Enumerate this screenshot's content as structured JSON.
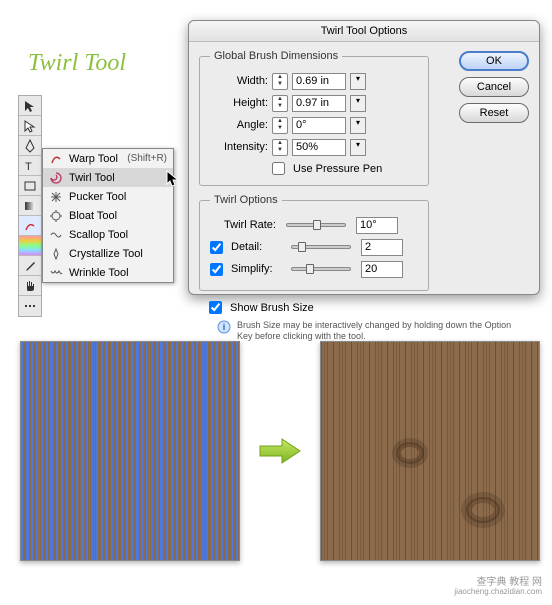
{
  "page_title": "Twirl Tool",
  "toolbar_tools": [
    "selection",
    "direct-select",
    "pen",
    "type",
    "shape",
    "gradient",
    "warp",
    "swatch"
  ],
  "flyout": {
    "items": [
      {
        "icon": "warp-icon",
        "label": "Warp Tool",
        "shortcut": "(Shift+R)",
        "selected": false
      },
      {
        "icon": "twirl-icon",
        "label": "Twirl Tool",
        "shortcut": "",
        "selected": true
      },
      {
        "icon": "pucker-icon",
        "label": "Pucker Tool",
        "shortcut": "",
        "selected": false
      },
      {
        "icon": "bloat-icon",
        "label": "Bloat Tool",
        "shortcut": "",
        "selected": false
      },
      {
        "icon": "scallop-icon",
        "label": "Scallop Tool",
        "shortcut": "",
        "selected": false
      },
      {
        "icon": "crystallize-icon",
        "label": "Crystallize Tool",
        "shortcut": "",
        "selected": false
      },
      {
        "icon": "wrinkle-icon",
        "label": "Wrinkle Tool",
        "shortcut": "",
        "selected": false
      }
    ]
  },
  "dialog": {
    "title": "Twirl Tool Options",
    "global": {
      "legend": "Global Brush Dimensions",
      "width_label": "Width:",
      "width_value": "0.69 in",
      "height_label": "Height:",
      "height_value": "0.97 in",
      "angle_label": "Angle:",
      "angle_value": "0°",
      "intensity_label": "Intensity:",
      "intensity_value": "50%",
      "unit": "in",
      "pressure_label": "Use Pressure Pen",
      "pressure_checked": false
    },
    "twirl": {
      "legend": "Twirl Options",
      "rate_label": "Twirl Rate:",
      "rate_value": "10°",
      "detail_label": "Detail:",
      "detail_value": "2",
      "detail_checked": true,
      "simplify_label": "Simplify:",
      "simplify_value": "20",
      "simplify_checked": true
    },
    "show_brush_label": "Show Brush Size",
    "show_brush_checked": true,
    "hint": "Brush Size may be interactively changed by holding down the Option Key before clicking with the tool.",
    "buttons": {
      "ok": "OK",
      "cancel": "Cancel",
      "reset": "Reset"
    }
  },
  "watermark": {
    "line1": "查字典 教程 网",
    "line2": "jiaocheng.chazidian.com"
  }
}
